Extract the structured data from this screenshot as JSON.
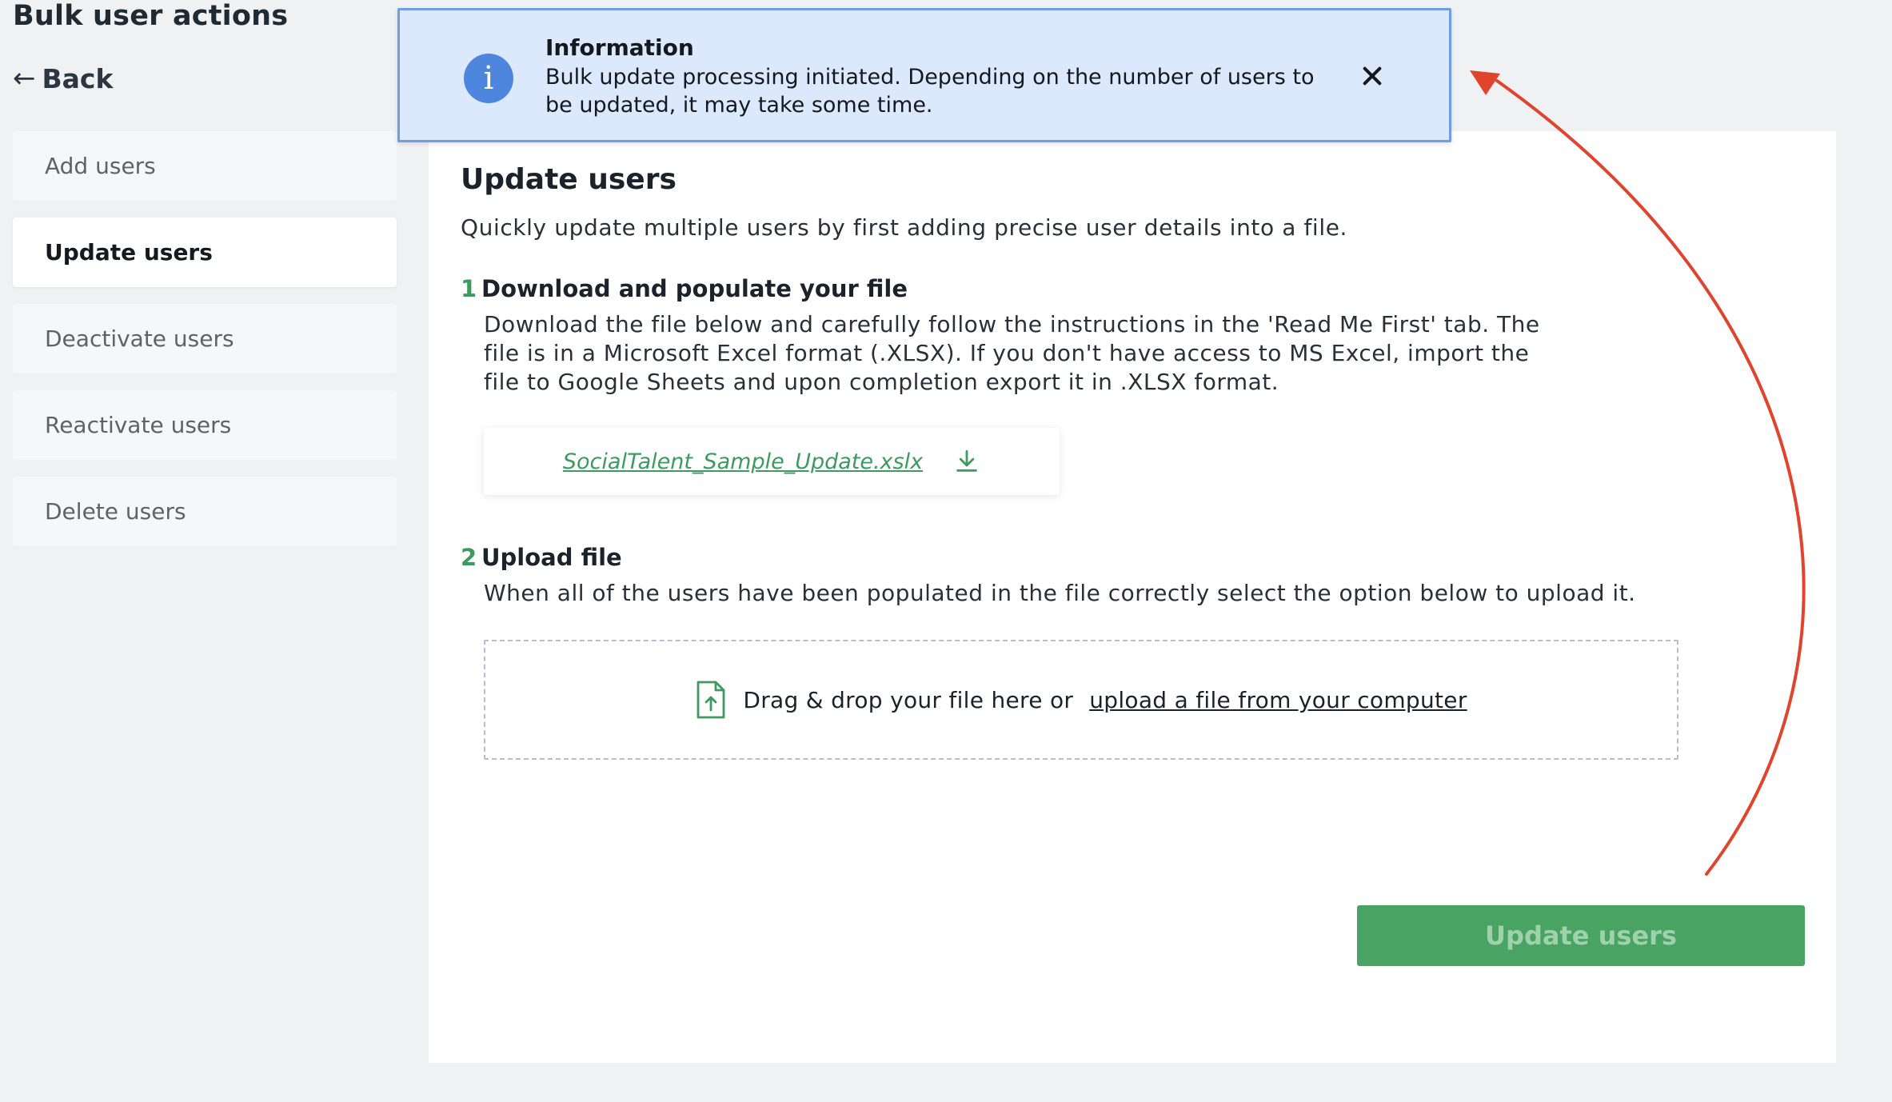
{
  "page": {
    "title": "Bulk user actions",
    "back_label": "Back"
  },
  "sidebar": {
    "items": [
      {
        "label": "Add users",
        "active": false
      },
      {
        "label": "Update users",
        "active": true
      },
      {
        "label": "Deactivate users",
        "active": false
      },
      {
        "label": "Reactivate users",
        "active": false
      },
      {
        "label": "Delete users",
        "active": false
      }
    ]
  },
  "toast": {
    "title": "Information",
    "message": "Bulk update processing initiated. Depending on the number of users to be updated, it may take some time.",
    "icon": "info-icon",
    "close_icon": "close-icon"
  },
  "main": {
    "title": "Update users",
    "description": "Quickly update multiple users by first adding precise user details into a file.",
    "steps": [
      {
        "number": "1",
        "title": "Download and populate your file",
        "body": "Download the file below and carefully follow the instructions in the 'Read Me First' tab. The file is in a Microsoft Excel format (.XLSX). If you don't have access to MS Excel, import the file to Google Sheets and upon completion export it in .XLSX format."
      },
      {
        "number": "2",
        "title": "Upload file",
        "body": "When all of the users have been populated in the file correctly select the option below to upload it."
      }
    ],
    "download": {
      "file_name": "SocialTalent_Sample_Update.xslx",
      "icon": "download-icon"
    },
    "dropzone": {
      "text": "Drag & drop your file here or",
      "link": "upload a file from your computer",
      "icon": "file-upload-icon"
    },
    "submit_label": "Update users"
  },
  "colors": {
    "accent_green": "#49a463",
    "info_blue": "#4f86dd",
    "toast_bg": "#dce9fc",
    "annotation_red": "#e0442c"
  }
}
